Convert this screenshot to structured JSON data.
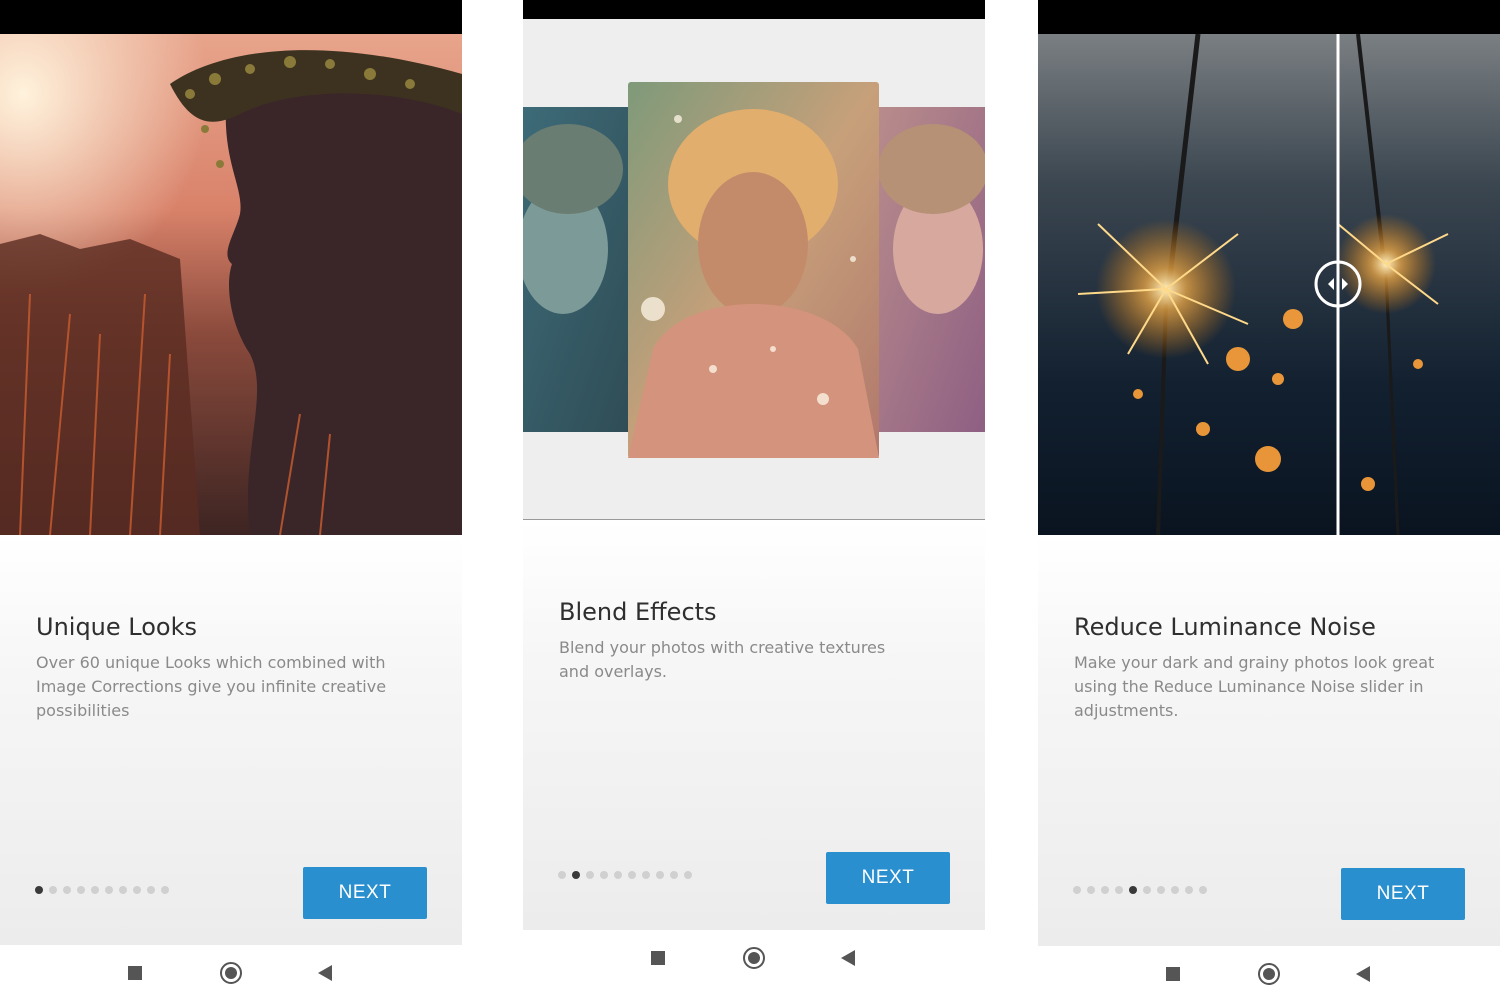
{
  "screens": [
    {
      "title": "Unique Looks",
      "description": "Over 60 unique Looks which combined with Image Corrections give you infinite creative possibilities",
      "next_label": "NEXT",
      "active_page": 1,
      "page_count": 10
    },
    {
      "title": "Blend Effects",
      "description": "Blend your photos with creative textures and overlays.",
      "next_label": "NEXT",
      "active_page": 2,
      "page_count": 10
    },
    {
      "title": "Reduce Luminance Noise",
      "description": "Make your dark and grainy photos look great using the Reduce Luminance Noise slider in adjustments.",
      "next_label": "NEXT",
      "active_page": 5,
      "page_count": 10
    }
  ],
  "nav_icons": [
    "recents-square-icon",
    "home-circle-icon",
    "back-triangle-icon"
  ],
  "colors": {
    "accent": "#2a8fcf",
    "title_text": "#2f2f2f",
    "body_text": "#8a8a8a",
    "dot_active": "#3a3a3a",
    "dot_inactive": "#d0d0d0"
  }
}
